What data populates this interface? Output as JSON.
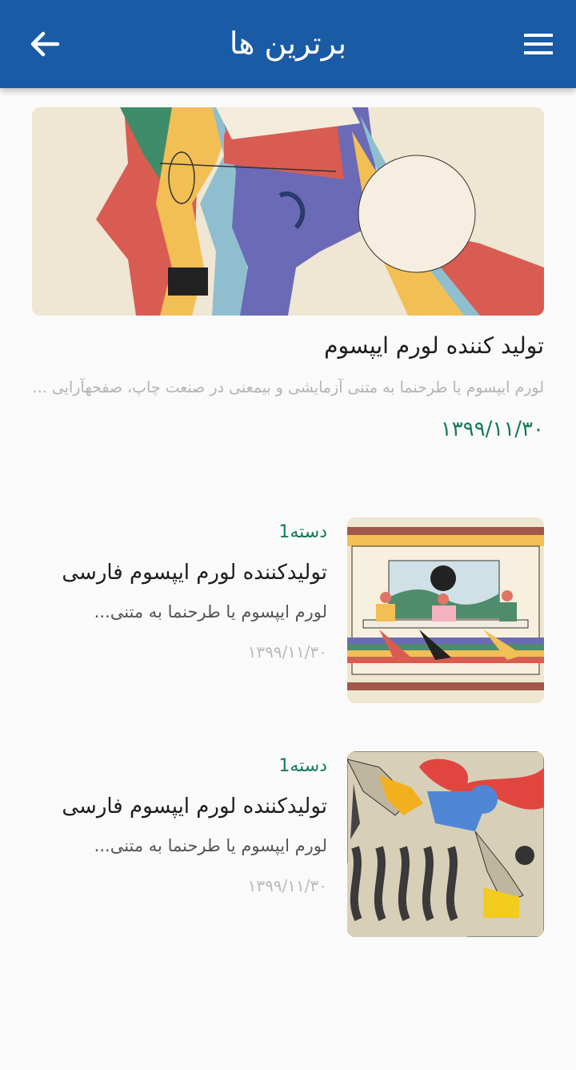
{
  "header": {
    "title": "برترین ها",
    "back_icon": "arrow-left-icon",
    "menu_icon": "hamburger-menu-icon",
    "background": "#1a5ba6"
  },
  "featured": {
    "title": "تولید کننده لورم ایپسوم",
    "excerpt": "لورم ایپسوم یا طرحنما به متنی آزمایشی و بیمعنی در صنعت چاپ، صفحهآرایی ...",
    "date": "۱۳۹۹/۱۱/۳۰"
  },
  "articles": [
    {
      "category": "دسته1",
      "title": "تولیدکننده لورم ایپسوم فارسی",
      "excerpt": "لورم ایپسوم یا طرحنما به متنی...",
      "date": "۱۳۹۹/۱۱/۳۰"
    },
    {
      "category": "دسته1",
      "title": "تولیدکننده لورم ایپسوم فارسی",
      "excerpt": "لورم ایپسوم یا طرحنما به متنی...",
      "date": "۱۳۹۹/۱۱/۳۰"
    }
  ],
  "colors": {
    "accent_green": "#167a5b",
    "page_background": "#fafafa"
  }
}
